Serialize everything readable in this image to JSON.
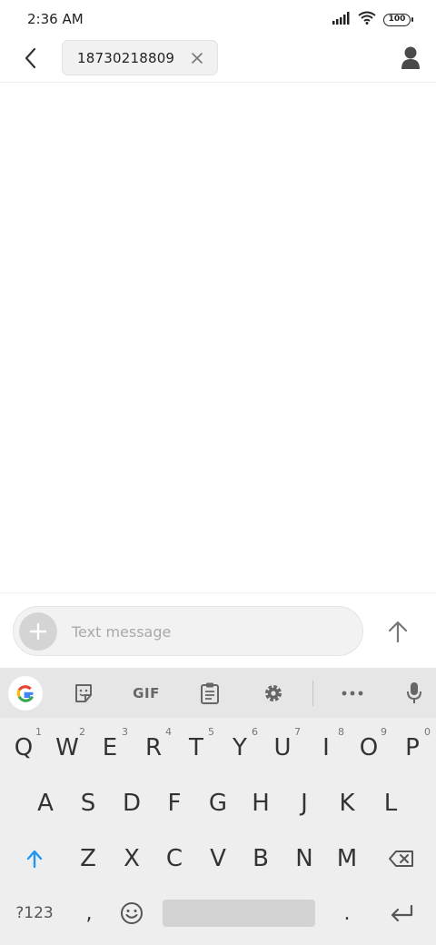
{
  "status_bar": {
    "time": "2:36 AM",
    "battery": "100",
    "icons": [
      "signal-icon",
      "wifi-icon",
      "battery-icon"
    ]
  },
  "header": {
    "back_icon": "chevron-left-icon",
    "recipient": "18730218809",
    "remove_icon": "close-icon",
    "contact_icon": "person-icon"
  },
  "compose": {
    "add_icon": "plus-icon",
    "placeholder": "Text message",
    "value": "",
    "send_icon": "arrow-up-icon"
  },
  "keyboard": {
    "toolbar": [
      "google-icon",
      "sticker-icon",
      "GIF",
      "clipboard-icon",
      "gear-icon",
      "more-icon",
      "mic-icon"
    ],
    "gif_label": "GIF",
    "row1": [
      "Q",
      "W",
      "E",
      "R",
      "T",
      "Y",
      "U",
      "I",
      "O",
      "P"
    ],
    "row1_hints": [
      "1",
      "2",
      "3",
      "4",
      "5",
      "6",
      "7",
      "8",
      "9",
      "0"
    ],
    "row2": [
      "A",
      "S",
      "D",
      "F",
      "G",
      "H",
      "J",
      "K",
      "L"
    ],
    "row3": [
      "Z",
      "X",
      "C",
      "V",
      "B",
      "N",
      "M"
    ],
    "symbols_label": "?123",
    "comma": ",",
    "period": ".",
    "colors": {
      "shift": "#2196F3",
      "keyboard_bg": "#eeeeee",
      "toolbar_bg": "#e6e6e6"
    }
  }
}
